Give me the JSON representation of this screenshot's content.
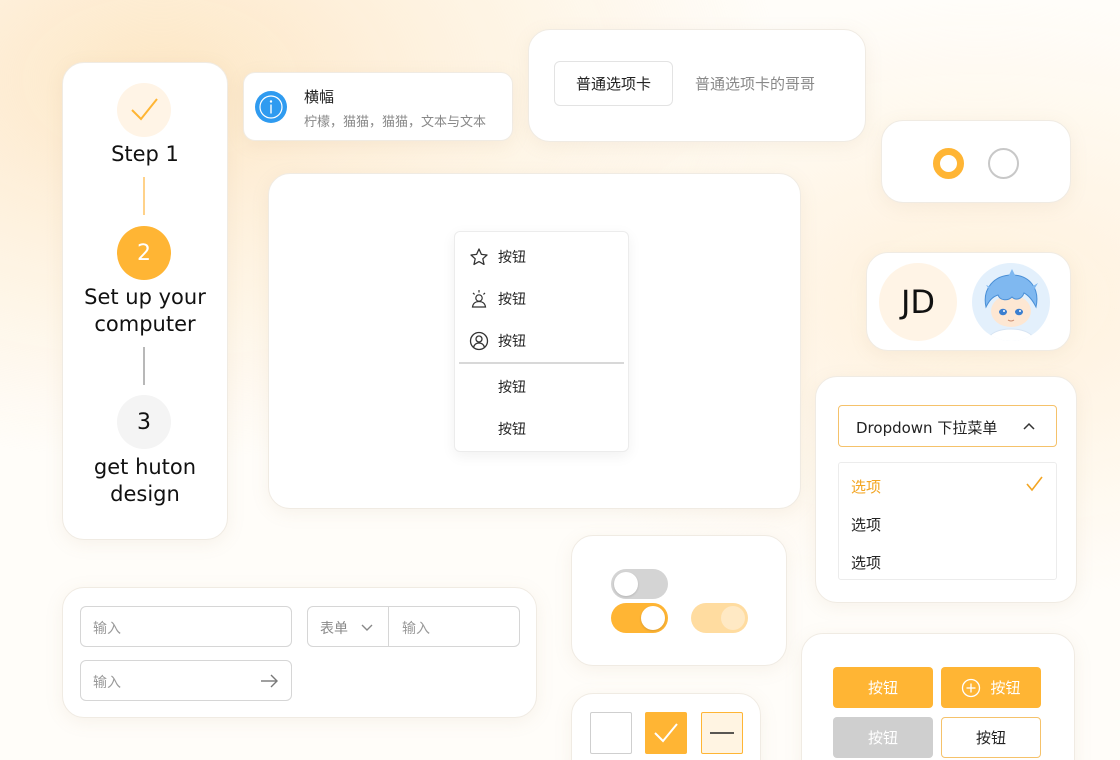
{
  "steps": [
    {
      "number": "",
      "title": "Step 1",
      "state": "done"
    },
    {
      "number": "2",
      "title_lines": [
        "Set up your",
        "computer"
      ],
      "state": "active"
    },
    {
      "number": "3",
      "title_lines": [
        "get huton",
        "design"
      ],
      "state": "pending"
    }
  ],
  "banner": {
    "icon": "info-icon",
    "title": "横幅",
    "text": "柠檬，猫猫，猫猫，文本与文本"
  },
  "tabs": [
    {
      "label": "普通选项卡",
      "active": true
    },
    {
      "label": "普通选项卡的哥哥",
      "active": false
    }
  ],
  "radios": [
    {
      "checked": true
    },
    {
      "checked": false
    }
  ],
  "avatars": {
    "initials": "JD",
    "image_avatar": "anime-character-avatar"
  },
  "menu": {
    "items": [
      {
        "label": "按钮",
        "icon": "star-icon"
      },
      {
        "label": "按钮",
        "icon": "person-sun-icon"
      },
      {
        "label": "按钮",
        "icon": "user-circle-icon"
      },
      {
        "label": "按钮",
        "icon": ""
      },
      {
        "label": "按钮",
        "icon": ""
      }
    ]
  },
  "dropdown": {
    "label": "Dropdown 下拉菜单",
    "open": true,
    "options": [
      {
        "label": "选项",
        "selected": true
      },
      {
        "label": "选项",
        "selected": false
      },
      {
        "label": "选项",
        "selected": false
      }
    ]
  },
  "inputs": {
    "input1_placeholder": "输入",
    "select_value": "表单",
    "input2_placeholder": "输入",
    "input3_placeholder": "输入"
  },
  "switches": [
    {
      "on": false,
      "disabled": false
    },
    {
      "on": true,
      "disabled": false
    },
    {
      "on": true,
      "disabled": true
    }
  ],
  "checkboxes": [
    {
      "state": "unchecked"
    },
    {
      "state": "checked"
    },
    {
      "state": "indeterminate"
    }
  ],
  "buttons": {
    "primary_label": "按钮",
    "primary_icon_label": "按钮",
    "disabled_label": "按钮",
    "outline_label": "按钮"
  },
  "colors": {
    "accent": "#ffb534",
    "accent_light": "#ffd699",
    "info_blue": "#2f9bf0",
    "disabled_grey": "#cfcfcf"
  }
}
